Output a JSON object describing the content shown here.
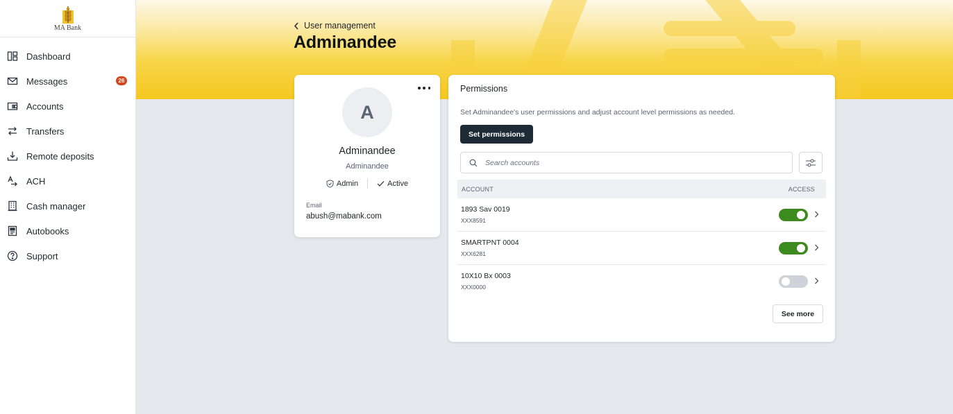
{
  "brand": {
    "name": "MA Bank"
  },
  "sidebar": {
    "items": [
      {
        "label": "Dashboard",
        "icon": "dashboard-icon"
      },
      {
        "label": "Messages",
        "icon": "mail-icon",
        "badge": "26"
      },
      {
        "label": "Accounts",
        "icon": "wallet-icon"
      },
      {
        "label": "Transfers",
        "icon": "transfer-arrows-icon"
      },
      {
        "label": "Remote deposits",
        "icon": "download-tray-icon"
      },
      {
        "label": "ACH",
        "icon": "ach-icon"
      },
      {
        "label": "Cash manager",
        "icon": "building-icon"
      },
      {
        "label": "Autobooks",
        "icon": "book-icon"
      },
      {
        "label": "Support",
        "icon": "question-circle-icon"
      }
    ]
  },
  "header": {
    "breadcrumb": "User management",
    "title": "Adminandee"
  },
  "profile": {
    "avatar_initial": "A",
    "name": "Adminandee",
    "username": "Adminandee",
    "role": "Admin",
    "status": "Active",
    "email_label": "Email",
    "email": "abush@mabank.com"
  },
  "permissions": {
    "title": "Permissions",
    "description": "Set Adminandee's user permissions and adjust account level permissions as needed.",
    "set_button": "Set permissions",
    "search_placeholder": "Search accounts",
    "columns": {
      "account": "ACCOUNT",
      "access": "ACCESS"
    },
    "rows": [
      {
        "name": "1893 Sav 0019",
        "number": "XXX8591",
        "access": true
      },
      {
        "name": "SMARTPNT 0004",
        "number": "XXX6281",
        "access": true
      },
      {
        "name": "10X10 Bx 0003",
        "number": "XXX0000",
        "access": false
      }
    ],
    "see_more": "See more"
  },
  "colors": {
    "brand_yellow": "#f5c71f",
    "primary_dark": "#1f2a37",
    "toggle_on": "#3d8a1f",
    "badge_red": "#d8441c"
  }
}
